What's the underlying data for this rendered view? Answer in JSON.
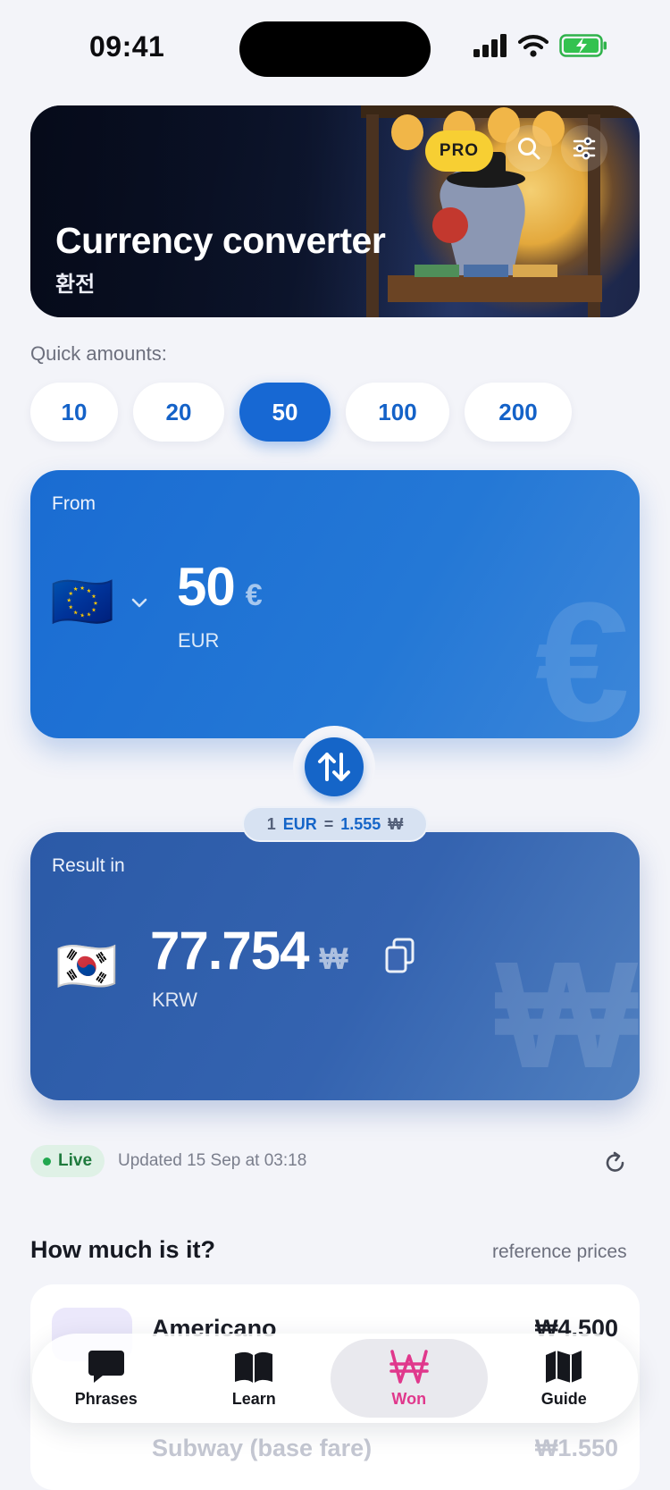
{
  "status": {
    "time": "09:41"
  },
  "header": {
    "title": "Currency converter",
    "subtitle": "환전",
    "pro_label": "PRO"
  },
  "quick": {
    "label": "Quick amounts:",
    "amounts": [
      "10",
      "20",
      "50",
      "100",
      "200"
    ],
    "selected": "50"
  },
  "from": {
    "label": "From",
    "flag": "🇪🇺",
    "amount": "50",
    "symbol": "€",
    "code": "EUR"
  },
  "rate": {
    "one": "1",
    "from": "EUR",
    "eq": "=",
    "value": "1.555",
    "symbol": "₩"
  },
  "result": {
    "label": "Result in",
    "flag": "🇰🇷",
    "amount": "77.754",
    "symbol": "₩",
    "code": "KRW"
  },
  "live": {
    "badge": "Live",
    "updated": "Updated 15 Sep at 03:18"
  },
  "prices": {
    "title": "How much is it?",
    "aside": "reference prices",
    "items": [
      {
        "name": "Americano",
        "value": "₩4.500"
      },
      {
        "name": "Subway (base fare)",
        "value": "₩1.550"
      }
    ]
  },
  "tabs": [
    {
      "label": "Phrases",
      "icon": "speech-bubble-icon"
    },
    {
      "label": "Learn",
      "icon": "book-icon"
    },
    {
      "label": "Won",
      "icon": "won-icon"
    },
    {
      "label": "Guide",
      "icon": "map-icon"
    }
  ],
  "colors": {
    "accent": "#1768d3",
    "active_tab": "#e0388c",
    "pro": "#f7cf33",
    "live": "#22a84f"
  }
}
